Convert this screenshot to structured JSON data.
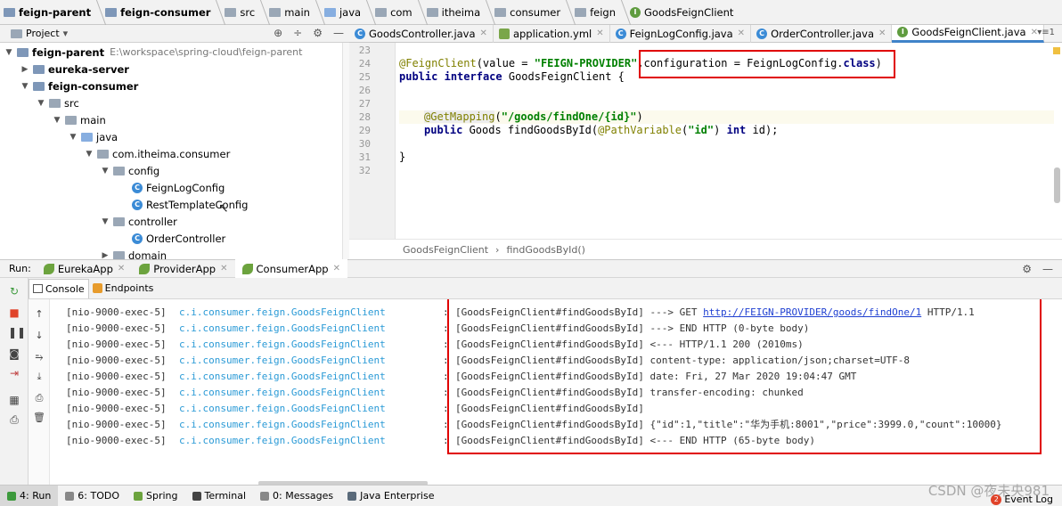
{
  "breadcrumb": [
    {
      "label": "feign-parent",
      "bold": true,
      "icon": "module-folder-icon"
    },
    {
      "label": "feign-consumer",
      "bold": true,
      "icon": "module-folder-icon"
    },
    {
      "label": "src",
      "icon": "folder-icon"
    },
    {
      "label": "main",
      "icon": "folder-icon"
    },
    {
      "label": "java",
      "icon": "source-folder-icon"
    },
    {
      "label": "com",
      "icon": "package-icon"
    },
    {
      "label": "itheima",
      "icon": "package-icon"
    },
    {
      "label": "consumer",
      "icon": "package-icon"
    },
    {
      "label": "feign",
      "icon": "package-icon"
    },
    {
      "label": "GoodsFeignClient",
      "icon": "interface-icon"
    }
  ],
  "project_panel": {
    "title": "Project",
    "dropdown_glyph": "▾",
    "tools": [
      "⊕",
      "÷",
      "⚙",
      "—"
    ]
  },
  "tree": [
    {
      "label": "feign-parent",
      "path": "E:\\workspace\\spring-cloud\\feign-parent",
      "bold": true
    },
    {
      "label": "eureka-server",
      "bold": true
    },
    {
      "label": "feign-consumer",
      "bold": true
    },
    {
      "label": "src"
    },
    {
      "label": "main"
    },
    {
      "label": "java"
    },
    {
      "label": "com.itheima.consumer"
    },
    {
      "label": "config"
    },
    {
      "label": "FeignLogConfig"
    },
    {
      "label": "RestTemplateConfig"
    },
    {
      "label": "controller"
    },
    {
      "label": "OrderController"
    },
    {
      "label": "domain"
    }
  ],
  "editor_tabs": [
    {
      "label": "GoodsController.java",
      "icon": "class-icon"
    },
    {
      "label": "application.yml",
      "icon": "yml-icon"
    },
    {
      "label": "FeignLogConfig.java",
      "icon": "class-icon"
    },
    {
      "label": "OrderController.java",
      "icon": "class-icon"
    },
    {
      "label": "GoodsFeignClient.java",
      "icon": "interface-icon",
      "active": true
    }
  ],
  "editor_tabs_menu": "▾≡1",
  "code": {
    "line_numbers": [
      "23",
      "24",
      "25",
      "26",
      "27",
      "28",
      "29",
      "30",
      "31",
      "32"
    ],
    "l24": {
      "ann": "@FeignClient",
      "p1": "(value = ",
      "str": "\"FEIGN-PROVIDER\"",
      "p2": ",configuration = FeignLogConfig.",
      "kw": "class",
      "p3": ")"
    },
    "l25": {
      "kw1": "public",
      "kw2": "interface",
      "rest": " GoodsFeignClient {"
    },
    "l28": {
      "ann": "@GetMapping",
      "p1": "(",
      "str": "\"/goods/findOne/{id}\"",
      "p2": ")"
    },
    "l29": {
      "kw1": "public",
      "p1": " Goods findGoodsById(",
      "ann": "@PathVariable",
      "p2": "(",
      "str": "\"id\"",
      "p3": ") ",
      "kw2": "int",
      "p4": " id);"
    },
    "l31": {
      "text": "}"
    }
  },
  "editor_breadcrumb": {
    "class_name": "GoodsFeignClient",
    "separator": "›",
    "method": "findGoodsById()"
  },
  "run_panel": {
    "label": "Run:",
    "tabs": [
      {
        "label": "EurekaApp"
      },
      {
        "label": "ProviderApp"
      },
      {
        "label": "ConsumerApp",
        "active": true
      }
    ],
    "sub_tabs": [
      {
        "label": "Console",
        "active": true
      },
      {
        "label": "Endpoints"
      }
    ]
  },
  "log_lines": [
    {
      "thread": "[nio-9000-exec-5]",
      "logger": "c.i.consumer.feign.GoodsFeignClient",
      "colon": ":",
      "msg_pre": "[GoodsFeignClient#findGoodsById] ---> GET ",
      "link": "http://FEIGN-PROVIDER/goods/findOne/1",
      "msg_post": " HTTP/1.1"
    },
    {
      "thread": "[nio-9000-exec-5]",
      "logger": "c.i.consumer.feign.GoodsFeignClient",
      "colon": ":",
      "msg_pre": "[GoodsFeignClient#findGoodsById] ---> END HTTP (0-byte body)"
    },
    {
      "thread": "[nio-9000-exec-5]",
      "logger": "c.i.consumer.feign.GoodsFeignClient",
      "colon": ":",
      "msg_pre": "[GoodsFeignClient#findGoodsById] <--- HTTP/1.1 200 (2010ms)"
    },
    {
      "thread": "[nio-9000-exec-5]",
      "logger": "c.i.consumer.feign.GoodsFeignClient",
      "colon": ":",
      "msg_pre": "[GoodsFeignClient#findGoodsById] content-type: application/json;charset=UTF-8"
    },
    {
      "thread": "[nio-9000-exec-5]",
      "logger": "c.i.consumer.feign.GoodsFeignClient",
      "colon": ":",
      "msg_pre": "[GoodsFeignClient#findGoodsById] date: Fri, 27 Mar 2020 19:04:47 GMT"
    },
    {
      "thread": "[nio-9000-exec-5]",
      "logger": "c.i.consumer.feign.GoodsFeignClient",
      "colon": ":",
      "msg_pre": "[GoodsFeignClient#findGoodsById] transfer-encoding: chunked"
    },
    {
      "thread": "[nio-9000-exec-5]",
      "logger": "c.i.consumer.feign.GoodsFeignClient",
      "colon": ":",
      "msg_pre": "[GoodsFeignClient#findGoodsById]"
    },
    {
      "thread": "[nio-9000-exec-5]",
      "logger": "c.i.consumer.feign.GoodsFeignClient",
      "colon": ":",
      "msg_pre": "[GoodsFeignClient#findGoodsById] {\"id\":1,\"title\":\"华为手机:8001\",\"price\":3999.0,\"count\":10000}"
    },
    {
      "thread": "[nio-9000-exec-5]",
      "logger": "c.i.consumer.feign.GoodsFeignClient",
      "colon": ":",
      "msg_pre": "[GoodsFeignClient#findGoodsById] <--- END HTTP (65-byte body)"
    }
  ],
  "status_bar": [
    {
      "label": "4: Run",
      "active": true
    },
    {
      "label": "6: TODO"
    },
    {
      "label": "Spring"
    },
    {
      "label": "Terminal"
    },
    {
      "label": "0: Messages"
    },
    {
      "label": "Java Enterprise"
    }
  ],
  "event_log": {
    "badge": "2",
    "label": "Event Log"
  },
  "watermark": "CSDN @夜未央981",
  "colors": {
    "highlight_box": "#e00000",
    "logger_text": "#2a9ad6",
    "link": "#1e3fd1",
    "active_tab_underline": "#4083c9"
  }
}
